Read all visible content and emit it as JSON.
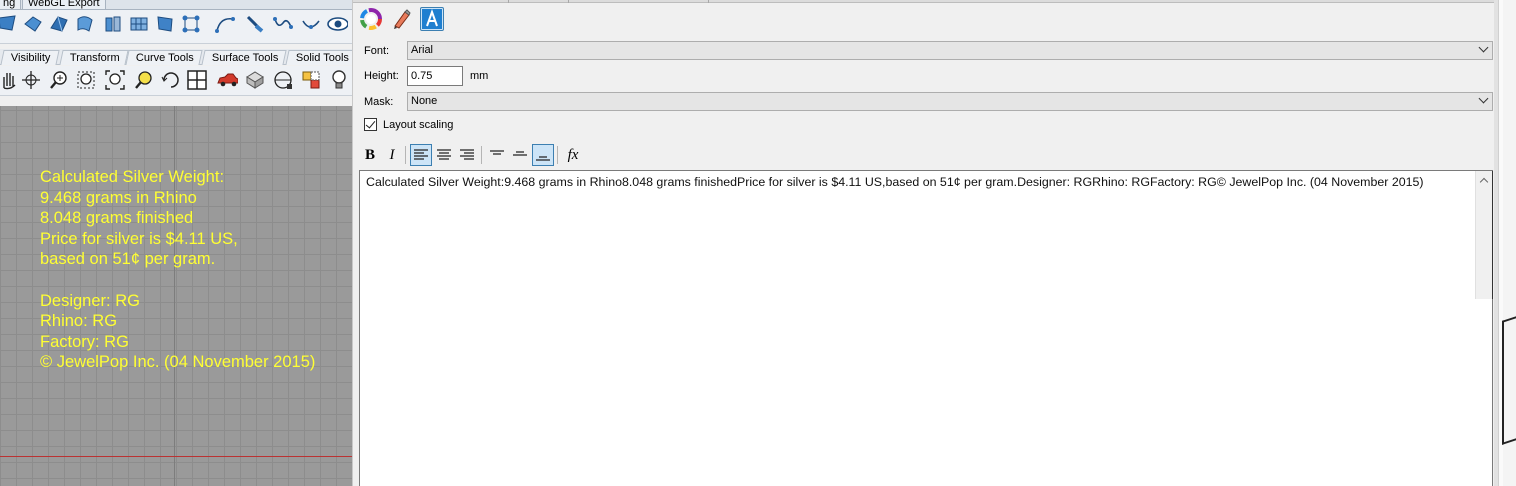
{
  "top_tabs": [
    "ng",
    "WebGL Export"
  ],
  "tool_tabs": [
    "Visibility",
    "Transform",
    "Curve Tools",
    "Surface Tools",
    "Solid Tools"
  ],
  "toolbar1_icons": [
    "surface-icon",
    "extrude-icon",
    "loft-icon",
    "sweep-icon",
    "blend-surface-icon",
    "network-surface-icon",
    "patch-icon",
    "control-points-icon",
    "curve-icon",
    "knife-icon",
    "rebuild-icon",
    "eye-icon"
  ],
  "toolbar2_icons": [
    "hand-pan-icon",
    "move-icon",
    "zoom-icon",
    "zoom-window-icon",
    "zoom-extents-icon",
    "zoom-selected-icon",
    "rotate-view-icon",
    "four-viewports-icon",
    "car-icon",
    "render-icon",
    "osnap-icon",
    "object-properties-icon",
    "light-bulb-icon"
  ],
  "viewport": {
    "text_lines": [
      "Calculated Silver Weight:",
      "9.468 grams in Rhino",
      "8.048 grams finished",
      "Price for silver is $4.11 US,",
      "based on 51¢ per gram.",
      "",
      "Designer: RG",
      "Rhino: RG",
      "Factory: RG",
      "© JewelPop Inc. (04 November 2015)"
    ],
    "text_color": "#ffff33"
  },
  "panel": {
    "tools": [
      "color-wheel-icon",
      "pen-brush-icon",
      "text-style-icon"
    ],
    "font_label": "Font:",
    "font_value": "Arial",
    "height_label": "Height:",
    "height_value": "0.75",
    "height_unit": "mm",
    "mask_label": "Mask:",
    "mask_value": "None",
    "layout_scaling_label": "Layout scaling",
    "layout_scaling_checked": true,
    "format_buttons": [
      "B",
      "I",
      "align-left",
      "align-center",
      "align-right",
      "valign-top",
      "valign-middle",
      "valign-bottom",
      "fx"
    ],
    "editor_text": "Calculated Silver Weight:9.468 grams in Rhino8.048 grams finishedPrice for silver is $4.11 US,based on 51¢ per gram.Designer: RGRhino: RGFactory: RG© JewelPop Inc. (04 November 2015)"
  }
}
